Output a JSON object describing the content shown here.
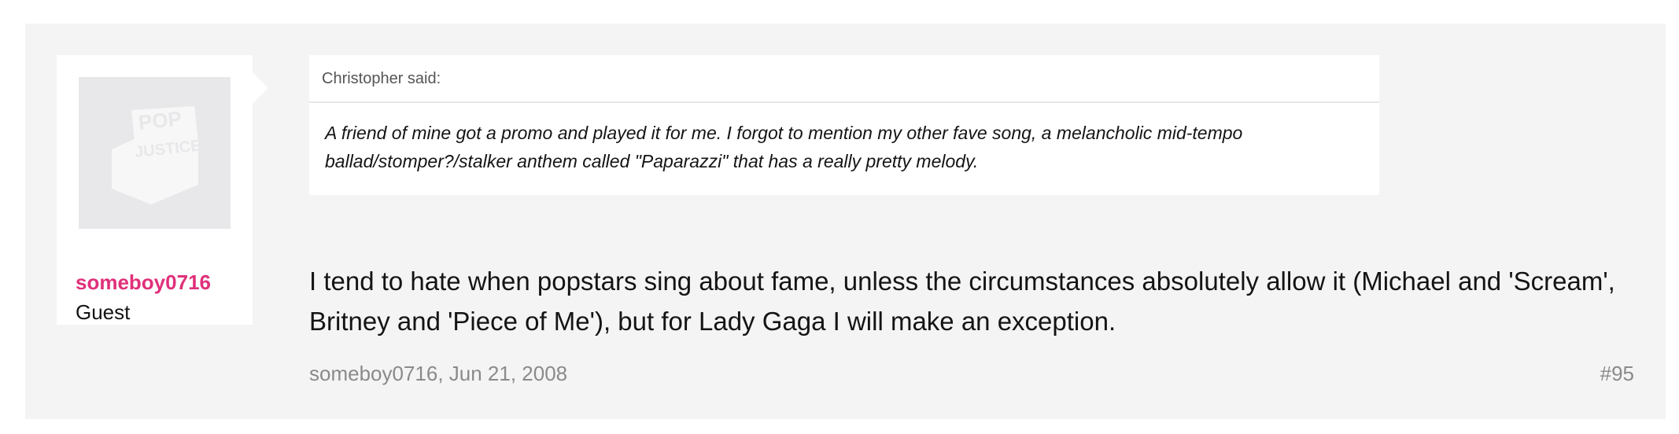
{
  "author": {
    "username": "someboy0716",
    "title": "Guest",
    "avatar_icon": "popjustice-logo-placeholder"
  },
  "quote": {
    "attribution": "Christopher said:",
    "text": "A friend of mine got a promo and played it for me. I forgot to mention my other fave song, a melancholic mid-tempo ballad/stomper?/stalker anthem called \"Paparazzi\" that has a really pretty melody."
  },
  "message": {
    "text": "I tend to hate when popstars sing about fame, unless the circumstances absolutely allow it (Michael and 'Scream', Britney and 'Piece of Me'), but for Lady Gaga I will make an exception."
  },
  "meta": {
    "author_date": "someboy0716, Jun 21, 2008",
    "post_number": "#95"
  },
  "colors": {
    "username": "#e0307a",
    "post_background": "#f4f4f4"
  }
}
